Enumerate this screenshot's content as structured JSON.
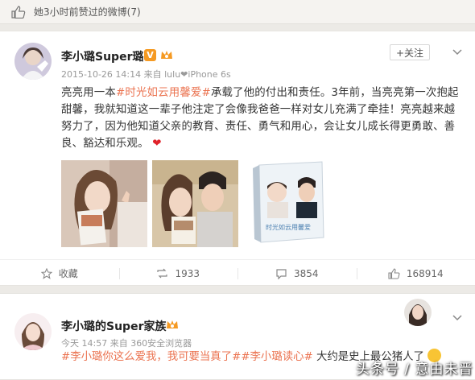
{
  "like_bar": {
    "text": "她3小时前赞过的微博(7)"
  },
  "post1": {
    "author": "李小璐Super璐",
    "verified_badge": "V",
    "follow_label": "+关注",
    "meta": "2015-10-26 14:14 来自 lulu❤iPhone 6s",
    "text_parts": {
      "p1": "亮亮用一本",
      "tag": "#时光如云用馨爱#",
      "p2": "承载了他的付出和责任。3年前，当亮亮第一次抱起甜馨，我就知道这一辈子他注定了会像我爸爸一样对女儿充满了牵挂！亮亮越来越努力了，因为他知道父亲的教育、责任、勇气和用心，会让女儿成长得更勇敢、善良、豁达和乐观。",
      "heart": "❤"
    },
    "images": [
      "photo-1",
      "photo-2",
      "book-cover"
    ],
    "book_title": "时光如云用馨爱",
    "actions": {
      "favorite": "收藏",
      "repost": "1933",
      "comment": "3854",
      "like": "168914"
    }
  },
  "post2": {
    "author": "李小璐的Super家族",
    "meta": "今天 14:57 来自 360安全浏览器",
    "text_parts": {
      "tag1": "#李小璐你这么爱我，我可要当真了#",
      "tag2": "#李小璐读心#",
      "p1": " 大约是史上最公猪人了"
    }
  },
  "watermark": "头条号 / 意由未晋",
  "colors": {
    "accent": "#eb7350",
    "badge": "#f59a23",
    "background": "#eceae6"
  }
}
